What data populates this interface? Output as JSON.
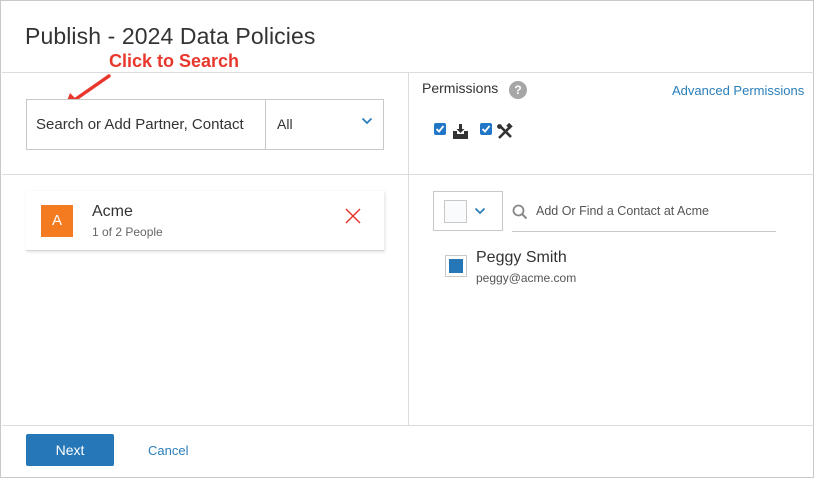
{
  "dialog": {
    "title": "Publish - 2024 Data Policies"
  },
  "annotation": {
    "text": "Click to Search",
    "color": "#e8382d"
  },
  "search": {
    "placeholder": "Search or Add Partner, Contact",
    "filter_value": "All"
  },
  "permissions": {
    "label": "Permissions",
    "help_glyph": "?",
    "advanced_link": "Advanced Permissions",
    "items": [
      {
        "checked": true,
        "icon": "download-tray-icon"
      },
      {
        "checked": true,
        "icon": "tools-icon"
      }
    ]
  },
  "partners": [
    {
      "initial": "A",
      "name": "Acme",
      "count": "1 of 2 People",
      "avatar_color": "#f47b20"
    }
  ],
  "contacts": {
    "search_placeholder": "Add Or Find a Contact at Acme",
    "items": [
      {
        "name": "Peggy Smith",
        "email": "peggy@acme.com",
        "checked": true
      }
    ]
  },
  "footer": {
    "next_label": "Next",
    "cancel_label": "Cancel"
  },
  "colors": {
    "primary": "#2577b8",
    "link": "#2a7fba",
    "remove": "#e8382d"
  }
}
